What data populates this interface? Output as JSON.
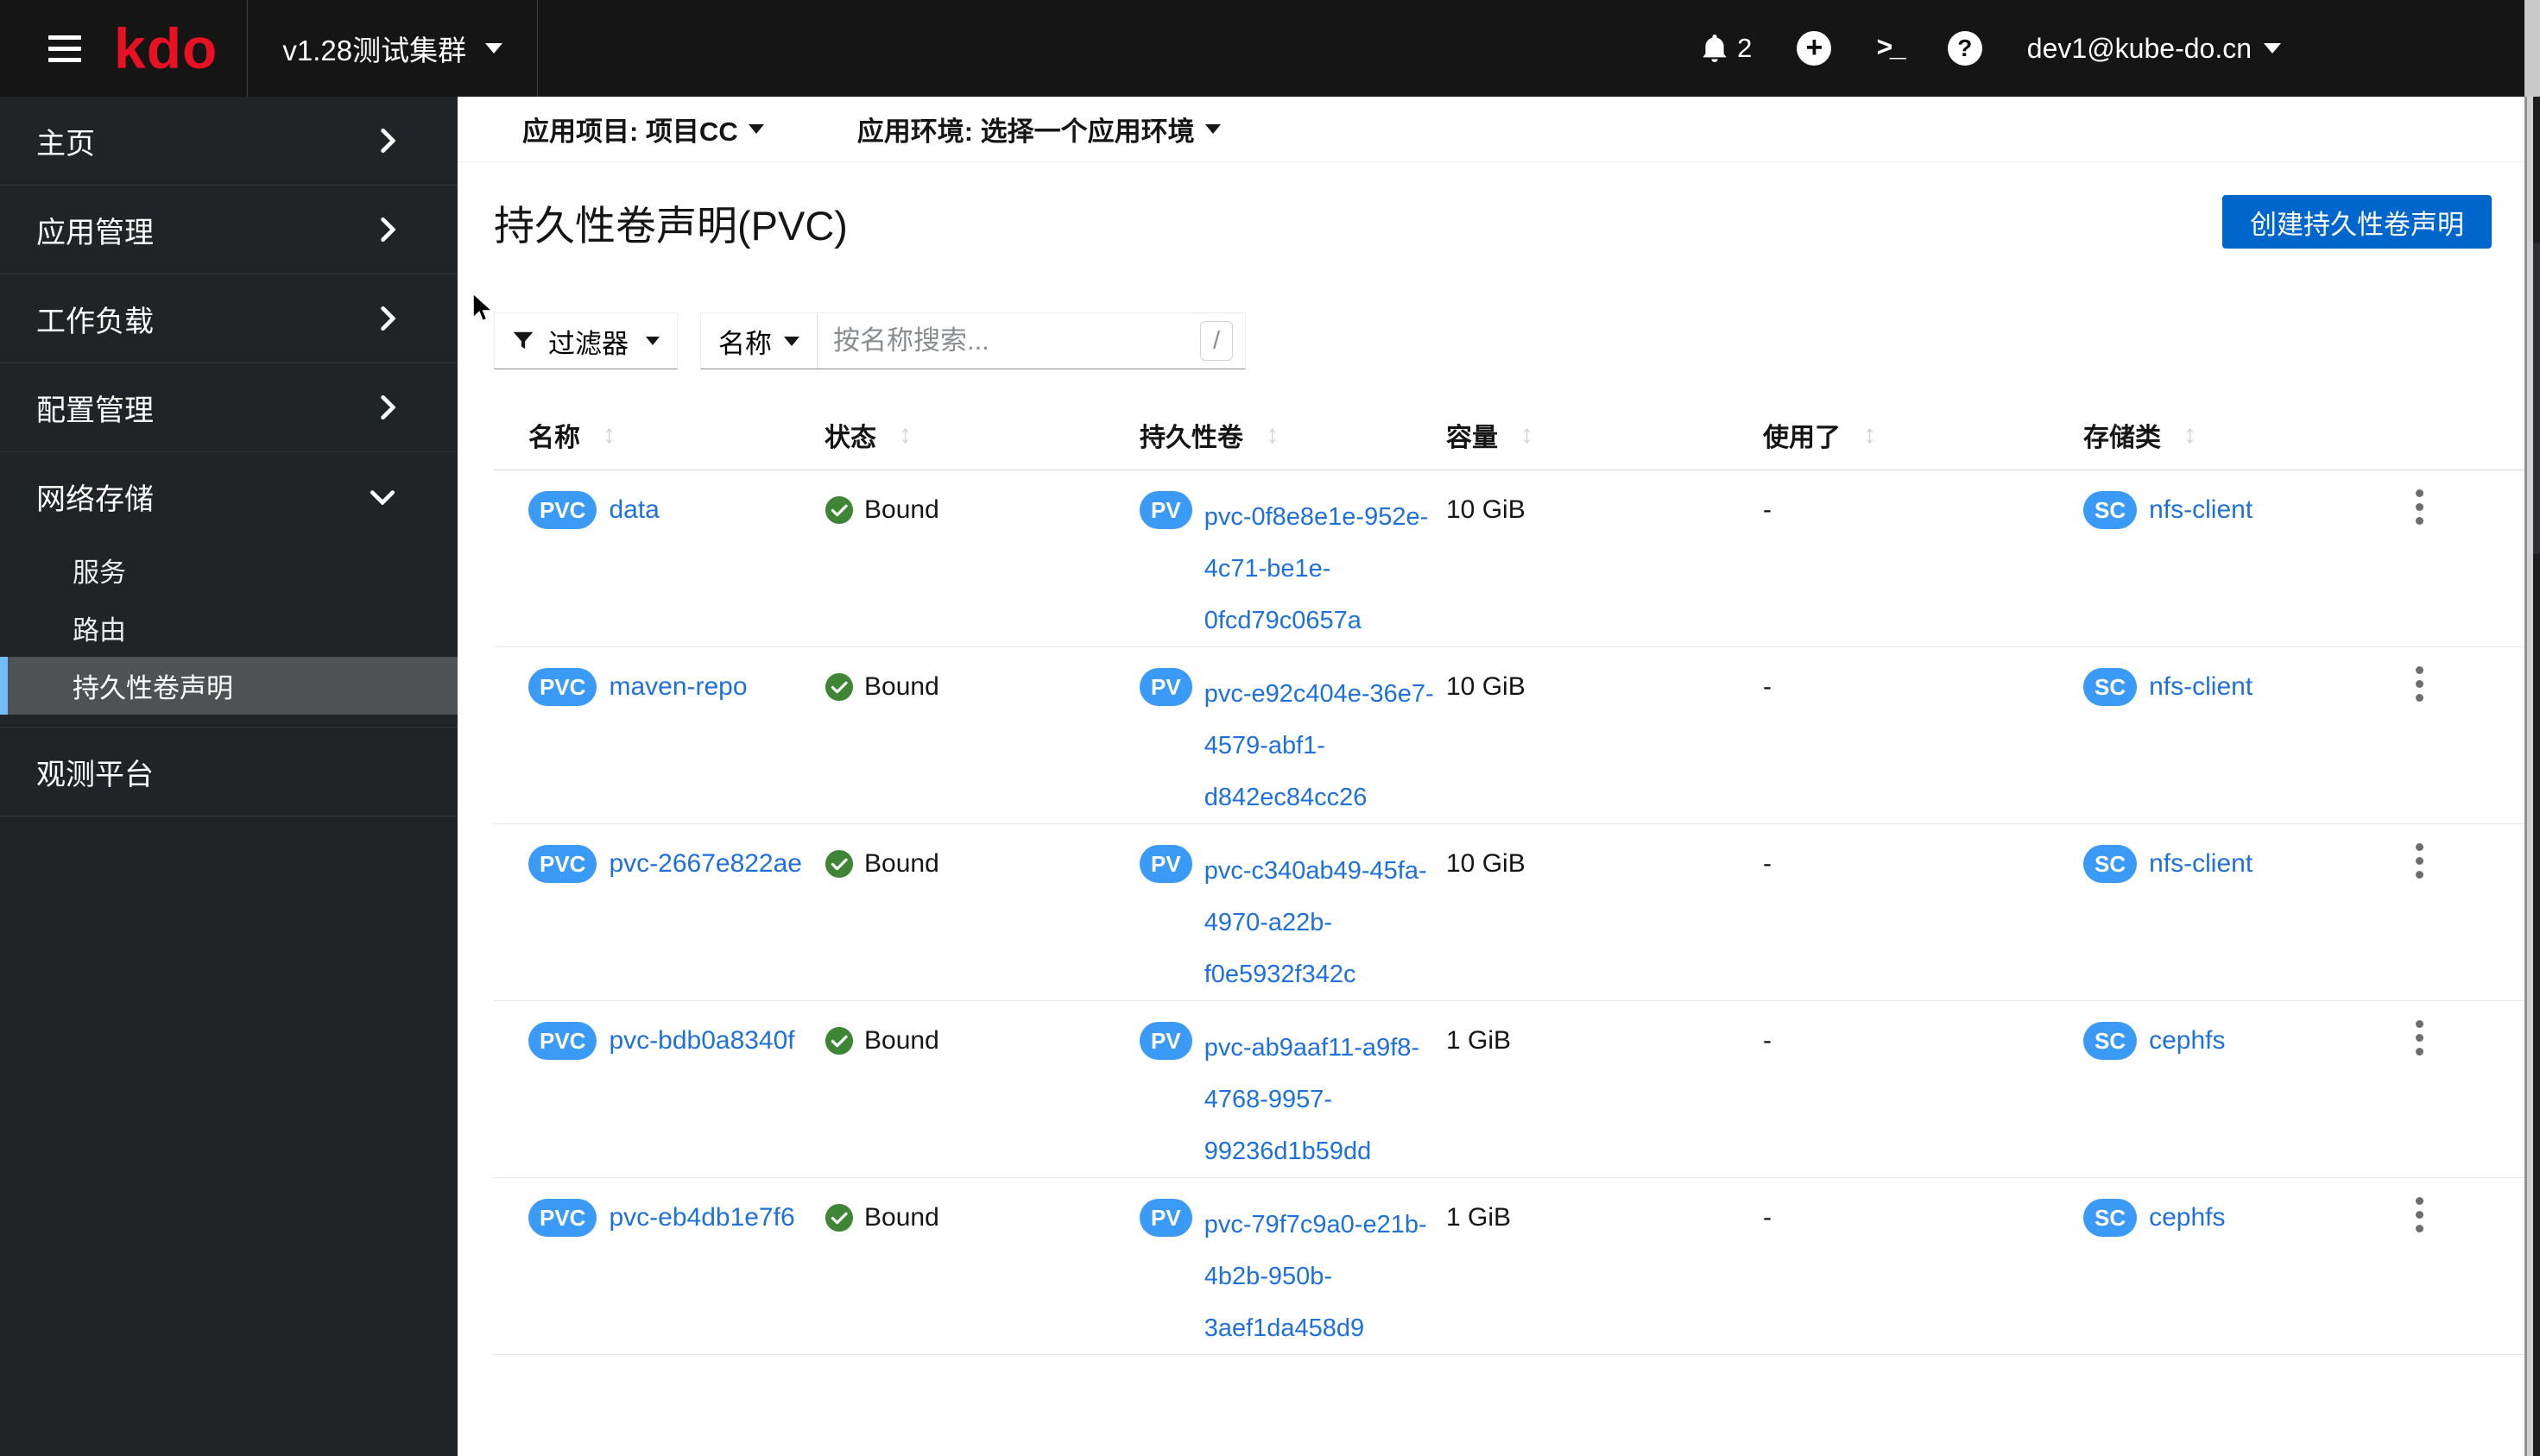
{
  "topbar": {
    "logo": "kdo",
    "cluster": "v1.28测试集群",
    "notification_count": "2",
    "username": "dev1@kube-do.cn"
  },
  "sidebar": {
    "items": [
      {
        "label": "主页"
      },
      {
        "label": "应用管理"
      },
      {
        "label": "工作负载"
      },
      {
        "label": "配置管理"
      },
      {
        "label": "网络存储"
      },
      {
        "label": "观测平台"
      }
    ],
    "network_children": [
      {
        "label": "服务"
      },
      {
        "label": "路由"
      },
      {
        "label": "持久性卷声明"
      }
    ]
  },
  "context_bar": {
    "project": "应用项目: 项目CC",
    "environment": "应用环境: 选择一个应用环境"
  },
  "page": {
    "title": "持久性卷声明(PVC)",
    "create_button": "创建持久性卷声明"
  },
  "toolbar": {
    "filter": "过滤器",
    "attribute": "名称",
    "search_placeholder": "按名称搜索...",
    "shortcut": "/"
  },
  "table": {
    "columns": [
      "名称",
      "状态",
      "持久性卷",
      "容量",
      "使用了",
      "存储类"
    ],
    "rows": [
      {
        "badge": "PVC",
        "name": "data",
        "status": "Bound",
        "pv_badge": "PV",
        "pv": "pvc-0f8e8e1e-952e-4c71-be1e-0fcd79c0657a",
        "capacity": "10 GiB",
        "used": "-",
        "sc_badge": "SC",
        "storage_class": "nfs-client"
      },
      {
        "badge": "PVC",
        "name": "maven-repo",
        "status": "Bound",
        "pv_badge": "PV",
        "pv": "pvc-e92c404e-36e7-4579-abf1-d842ec84cc26",
        "capacity": "10 GiB",
        "used": "-",
        "sc_badge": "SC",
        "storage_class": "nfs-client"
      },
      {
        "badge": "PVC",
        "name": "pvc-2667e822ae",
        "status": "Bound",
        "pv_badge": "PV",
        "pv": "pvc-c340ab49-45fa-4970-a22b-f0e5932f342c",
        "capacity": "10 GiB",
        "used": "-",
        "sc_badge": "SC",
        "storage_class": "nfs-client"
      },
      {
        "badge": "PVC",
        "name": "pvc-bdb0a8340f",
        "status": "Bound",
        "pv_badge": "PV",
        "pv": "pvc-ab9aaf11-a9f8-4768-9957-99236d1b59dd",
        "capacity": "1 GiB",
        "used": "-",
        "sc_badge": "SC",
        "storage_class": "cephfs"
      },
      {
        "badge": "PVC",
        "name": "pvc-eb4db1e7f6",
        "status": "Bound",
        "pv_badge": "PV",
        "pv": "pvc-79f7c9a0-e21b-4b2b-950b-3aef1da458d9",
        "capacity": "1 GiB",
        "used": "-",
        "sc_badge": "SC",
        "storage_class": "cephfs"
      }
    ]
  },
  "colors": {
    "primary": "#0066cc",
    "link": "#1e70dc",
    "resource_badge": "#3b9af6",
    "success_green": "#3e8635",
    "topbar_bg": "#151515",
    "sidebar_bg": "#212427",
    "sidebar_active_bg": "#4f5255",
    "sidebar_active_border": "#73bcf7",
    "logo_red": "#e81123"
  }
}
